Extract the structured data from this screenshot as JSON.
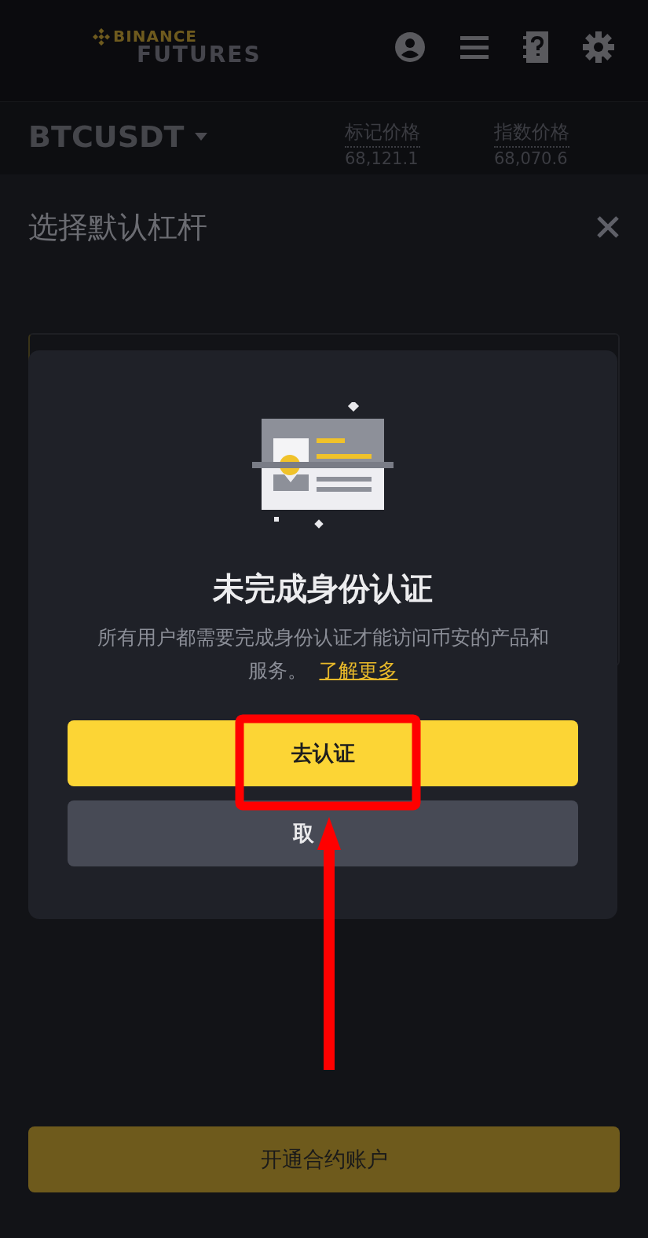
{
  "header": {
    "brand": "BINANCE",
    "product": "FUTURES"
  },
  "market": {
    "symbol": "BTCUSDT",
    "prices": [
      {
        "label": "标记价格",
        "value": "68,121.1"
      },
      {
        "label": "指数价格",
        "value": "68,070.6"
      }
    ]
  },
  "sheet": {
    "title": "选择默认杠杆",
    "action_button": "开通合约账户"
  },
  "dialog": {
    "title": "未完成身份认证",
    "message": "所有用户都需要完成身份认证才能访问币安的产品和服务。",
    "link": "了解更多",
    "buttons": [
      {
        "label": "去认证",
        "kind": "primary"
      },
      {
        "label": "取",
        "kind": "secondary"
      }
    ]
  }
}
